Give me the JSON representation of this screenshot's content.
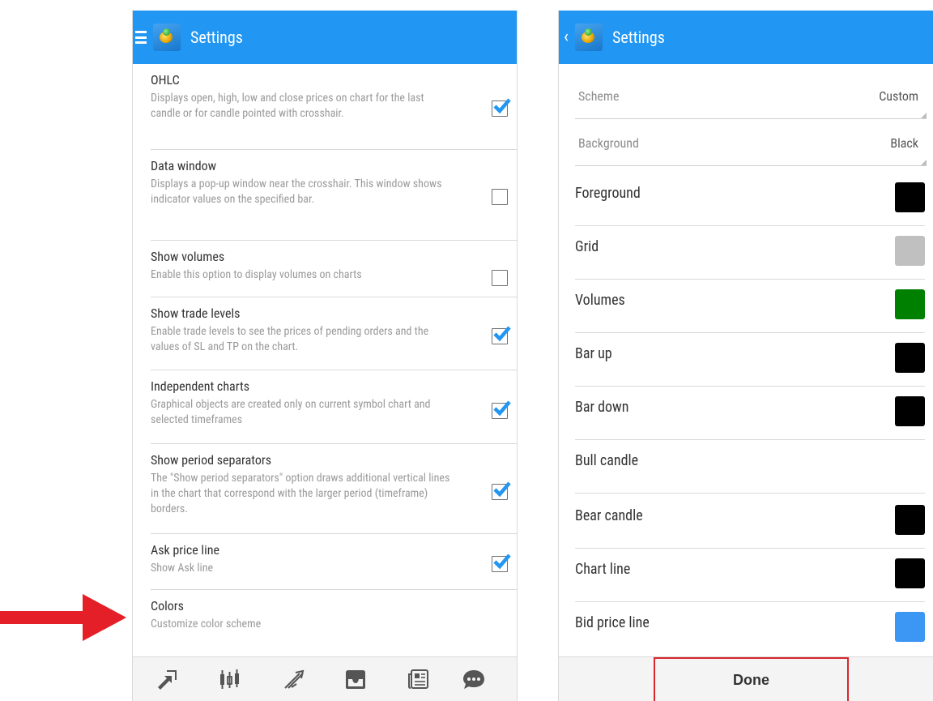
{
  "left_screen": {
    "title": "Settings",
    "settings": [
      {
        "title": "OHLC",
        "description": "Displays open, high, low and close prices on chart for the last candle or for candle pointed with crosshair.",
        "checked": true
      },
      {
        "title": "Data window",
        "description": "Displays a pop-up window near the crosshair. This window shows indicator values on the specified bar.",
        "checked": false
      },
      {
        "title": "Show volumes",
        "description": "Enable this option to display volumes on charts",
        "checked": false
      },
      {
        "title": "Show trade levels",
        "description": "Enable trade levels to see the prices of pending orders and the values of SL and TP on the chart.",
        "checked": true
      },
      {
        "title": "Independent charts",
        "description": "Graphical objects are created only on current symbol chart and selected timeframes",
        "checked": true
      },
      {
        "title": "Show period separators",
        "description": "The \"Show period separators\" option draws additional vertical lines in the chart that correspond with the larger period (timeframe) borders.",
        "checked": true
      },
      {
        "title": "Ask price line",
        "description": "Show Ask line",
        "checked": true
      },
      {
        "title": "Colors",
        "description": "Customize color scheme"
      }
    ],
    "bottom_tabs": [
      "quotes-icon",
      "chart-icon",
      "trade-icon",
      "history-icon",
      "news-icon",
      "chat-icon"
    ]
  },
  "right_screen": {
    "title": "Settings",
    "scheme": {
      "label": "Scheme",
      "value": "Custom"
    },
    "background": {
      "label": "Background",
      "value": "Black"
    },
    "colors": [
      {
        "label": "Foreground",
        "swatch": "#000000"
      },
      {
        "label": "Grid",
        "swatch": "#c0c0c0"
      },
      {
        "label": "Volumes",
        "swatch": "#008000"
      },
      {
        "label": "Bar up",
        "swatch": "#000000"
      },
      {
        "label": "Bar down",
        "swatch": "#000000"
      },
      {
        "label": "Bull candle",
        "swatch": null
      },
      {
        "label": "Bear candle",
        "swatch": "#000000"
      },
      {
        "label": "Chart line",
        "swatch": "#000000"
      },
      {
        "label": "Bid price line",
        "swatch": "#3c97f4"
      }
    ],
    "done_label": "Done"
  },
  "accent_colors": {
    "app_bar": "#2196f3",
    "checkbox_check": "#2196f3",
    "annotation": "#e41f27"
  }
}
